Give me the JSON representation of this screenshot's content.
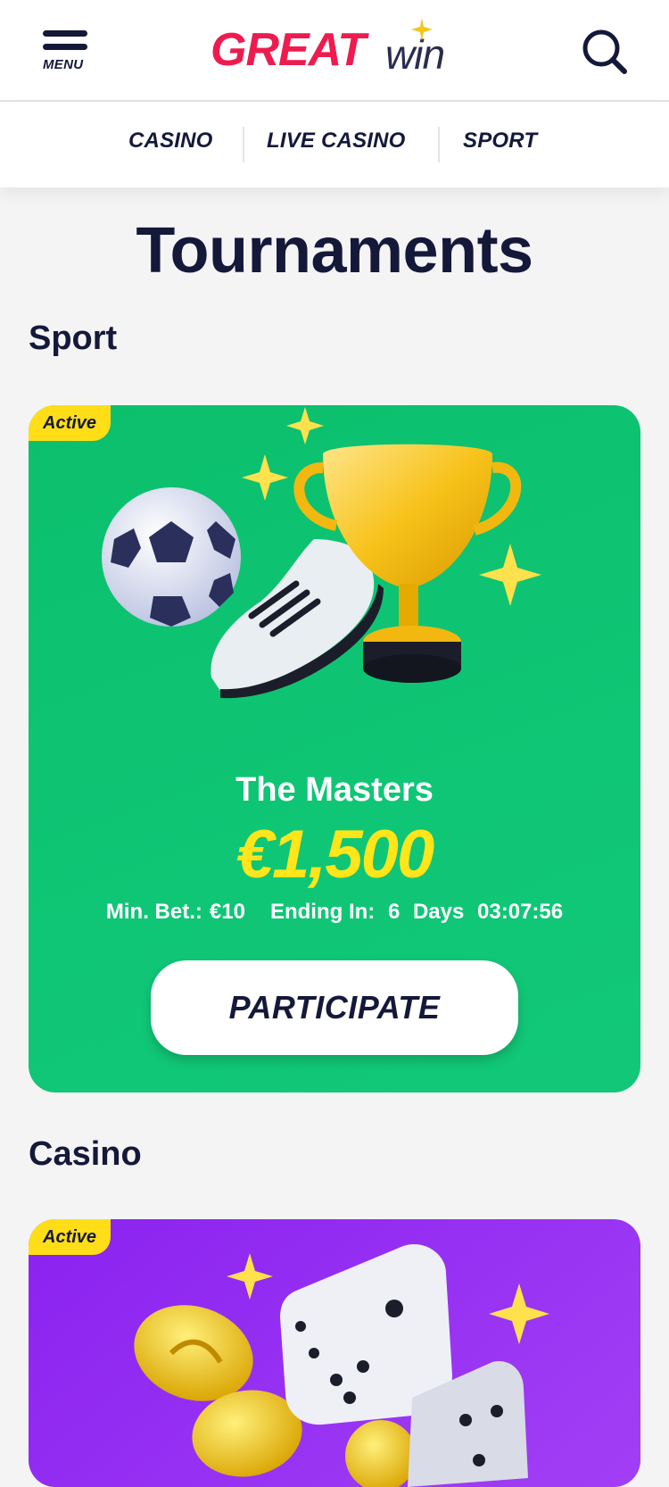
{
  "header": {
    "menu_label": "MENU",
    "logo_great": "GREAT",
    "logo_win": "win"
  },
  "nav": {
    "items": [
      {
        "label": "CASINO"
      },
      {
        "label": "LIVE CASINO"
      },
      {
        "label": "SPORT"
      }
    ]
  },
  "page": {
    "title": "Tournaments"
  },
  "sections": [
    {
      "title": "Sport",
      "card": {
        "badge": "Active",
        "name": "The Masters",
        "prize": "€1,500",
        "min_bet_label": "Min. Bet.:",
        "min_bet_value": "€10",
        "ending_label": "Ending In:",
        "days_value": "6",
        "days_label": "Days",
        "time_value": "03:07:56",
        "button": "PARTICIPATE"
      }
    },
    {
      "title": "Casino",
      "card": {
        "badge": "Active"
      }
    }
  ],
  "icons": {
    "menu": "hamburger-menu-icon",
    "search": "search-icon",
    "sport_art": [
      "soccer-ball-icon",
      "football-boot-icon",
      "trophy-icon",
      "sparkle-icon"
    ],
    "casino_art": [
      "gold-coin-icon",
      "dice-icon",
      "sparkle-icon"
    ]
  },
  "colors": {
    "brand_red": "#ee1b4f",
    "navy": "#14193a",
    "sport_card": "#0fc676",
    "casino_card": "#9a30f3",
    "badge_yellow": "#ffde17",
    "prize_yellow": "#ffe51a"
  }
}
